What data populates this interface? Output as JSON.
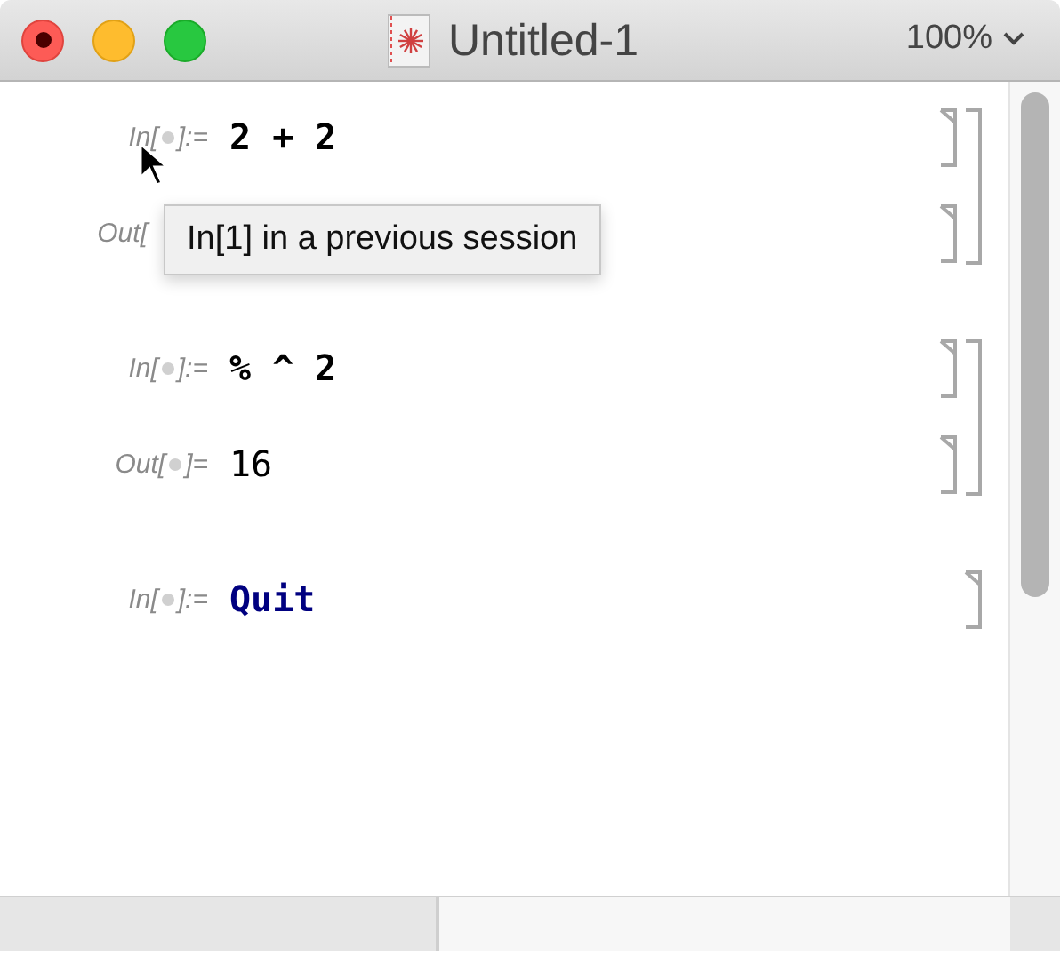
{
  "window": {
    "title": "Untitled-1",
    "zoom": "100%"
  },
  "groups": [
    {
      "cells": [
        {
          "kind": "input",
          "label_start": "In[",
          "label_end": "]:=",
          "code": "2 + 2"
        },
        {
          "kind": "output",
          "label_start": "Out["
        }
      ]
    },
    {
      "cells": [
        {
          "kind": "input",
          "label_start": "In[",
          "label_end": "]:=",
          "code": "% ^ 2"
        },
        {
          "kind": "output",
          "label_start": "Out[",
          "label_end": "]=",
          "code": "16"
        }
      ]
    },
    {
      "cells": [
        {
          "kind": "symbol",
          "label_start": "In[",
          "label_end": "]:=",
          "code": "Quit"
        }
      ]
    }
  ],
  "tooltip": "In[1] in a previous session"
}
